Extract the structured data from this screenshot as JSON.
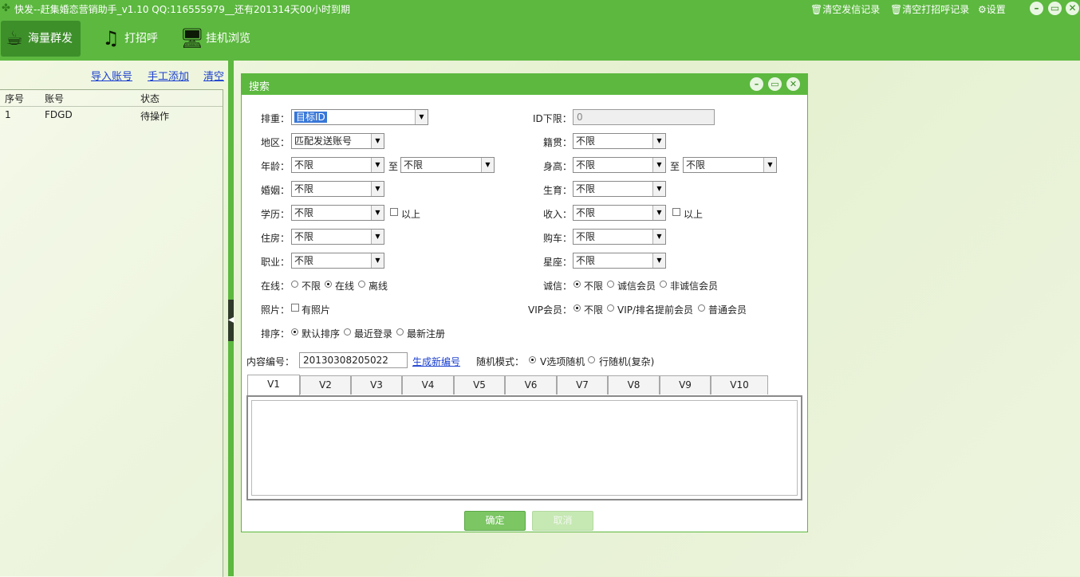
{
  "window": {
    "title": "快发--赶集婚恋营销助手_v1.10  QQ:116555979__还有201314天00小时到期",
    "links": [
      "清空发信记录",
      "清空打招呼记录",
      "设置"
    ],
    "controls": [
      "minimize",
      "restore",
      "close"
    ]
  },
  "toolbar": {
    "items": [
      {
        "label": "海量群发",
        "icon": "coffee-cup-icon",
        "active": true
      },
      {
        "label": "打招呼",
        "icon": "music-note-icon",
        "active": false
      },
      {
        "label": "挂机浏览",
        "icon": "monitor-icon",
        "active": false
      }
    ]
  },
  "accounts": {
    "actions": [
      "导入账号",
      "手工添加",
      "清空"
    ],
    "columns": [
      "序号",
      "账号",
      "状态"
    ],
    "rows": [
      [
        "1",
        "FDGD",
        "待操作"
      ]
    ]
  },
  "dialog": {
    "title": "搜索",
    "left": {
      "weight_label": "排重：",
      "weight_value": "目标ID",
      "region_label": "地区：",
      "region_value": "匹配发送账号",
      "age_label": "年龄：",
      "age_from": "不限",
      "to": "至",
      "age_to": "不限",
      "marriage_label": "婚姻：",
      "marriage_value": "不限",
      "edu_label": "学历：",
      "edu_value": "不限",
      "edu_above": "以上",
      "house_label": "住房：",
      "house_value": "不限",
      "job_label": "职业：",
      "job_value": "不限",
      "online_label": "在线：",
      "online_options": [
        "不限",
        "在线",
        "离线"
      ],
      "online_selected": "在线",
      "photo_label": "照片：",
      "photo_option": "有照片",
      "sort_label": "排序：",
      "sort_options": [
        "默认排序",
        "最近登录",
        "最新注册"
      ],
      "sort_selected": "默认排序"
    },
    "right": {
      "id_label": "ID下限：",
      "id_value": "0",
      "native_label": "籍贯：",
      "native_value": "不限",
      "height_label": "身高：",
      "height_from": "不限",
      "to": "至",
      "height_to": "不限",
      "birth_label": "生育：",
      "birth_value": "不限",
      "income_label": "收入：",
      "income_value": "不限",
      "income_above": "以上",
      "car_label": "购车：",
      "car_value": "不限",
      "star_label": "星座：",
      "star_value": "不限",
      "honest_label": "诚信：",
      "honest_options": [
        "不限",
        "诚信会员",
        "非诚信会员"
      ],
      "honest_selected": "不限",
      "vip_label": "VIP会员：",
      "vip_options": [
        "不限",
        "VIP/排名提前会员",
        "普通会员"
      ],
      "vip_selected": "不限"
    },
    "content_label": "内容编号：",
    "content_value": "20130308205022",
    "gen_link": "生成新编号",
    "random_label": "随机模式：",
    "random_options": [
      "V选项随机",
      "行随机(复杂)"
    ],
    "random_selected": "V选项随机",
    "tabs": [
      "V1",
      "V2",
      "V3",
      "V4",
      "V5",
      "V6",
      "V7",
      "V8",
      "V9",
      "V10"
    ],
    "active_tab": "V1",
    "ok": "确定",
    "cancel": "取消"
  },
  "colors": {
    "brand_green": "#5cb83f",
    "dark_green": "#3d8f2a",
    "selection_blue": "#3877d8",
    "link_blue": "#1a3fd0"
  }
}
